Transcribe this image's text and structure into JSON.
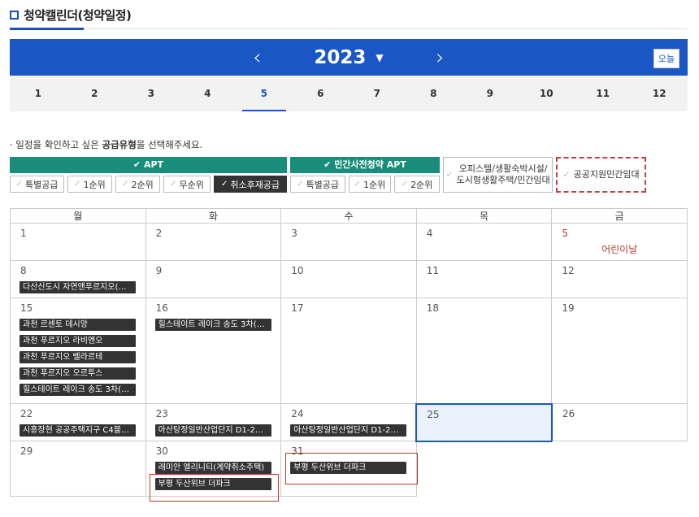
{
  "page_title": "청약캘린더(청약일정)",
  "year": "2023",
  "today_label": "오늘",
  "months": [
    "1",
    "2",
    "3",
    "4",
    "5",
    "6",
    "7",
    "8",
    "9",
    "10",
    "11",
    "12"
  ],
  "active_month": "5",
  "notice_prefix": "· 일정을 확인하고 싶은 ",
  "notice_bold": "공급유형",
  "notice_suffix": "을 선택해주세요.",
  "apt_group": {
    "label": "APT",
    "chips": [
      "특별공급",
      "1순위",
      "2순위",
      "무순위",
      "취소후재공급"
    ],
    "selected": "취소후재공급"
  },
  "pre_group": {
    "label": "민간사전청약 APT",
    "chips": [
      "특별공급",
      "1순위",
      "2순위"
    ]
  },
  "officetel": {
    "line1": "오피스텔/생활숙박시설/",
    "line2": "도시형생활주택/민간임대"
  },
  "public_rental": "공공지원민간임대",
  "weekdays": [
    "월",
    "화",
    "수",
    "목",
    "금"
  ],
  "weeks": [
    [
      {
        "day": "1",
        "events": []
      },
      {
        "day": "2",
        "events": []
      },
      {
        "day": "3",
        "events": []
      },
      {
        "day": "4",
        "events": []
      },
      {
        "day": "5",
        "holiday": "어린이날",
        "events": []
      }
    ],
    [
      {
        "day": "8",
        "events": [
          "다산신도시 자연앤푸르지오(계…"
        ]
      },
      {
        "day": "9",
        "events": []
      },
      {
        "day": "10",
        "events": []
      },
      {
        "day": "11",
        "events": []
      },
      {
        "day": "12",
        "events": []
      }
    ],
    [
      {
        "day": "15",
        "events": [
          "과천 르센토 데시앙",
          "과천 푸르지오 라비엔오",
          "과천 푸르지오 벨라르테",
          "과천 푸르지오 오르투스",
          "힐스테이트 레이크 송도 3차(계…"
        ]
      },
      {
        "day": "16",
        "events": [
          "힐스테이트 레이크 송도 3차(계…"
        ]
      },
      {
        "day": "17",
        "events": []
      },
      {
        "day": "18",
        "events": []
      },
      {
        "day": "19",
        "events": []
      }
    ],
    [
      {
        "day": "22",
        "events": [
          "시흥장현 공공주택지구 C4블록 …"
        ]
      },
      {
        "day": "23",
        "events": [
          "아산탕정일반산업단지 D1-2BL …"
        ]
      },
      {
        "day": "24",
        "events": [
          "아산탕정일반산업단지 D1-2BL…"
        ]
      },
      {
        "day": "25",
        "events": []
      },
      {
        "day": "26",
        "events": []
      }
    ],
    [
      {
        "day": "29",
        "events": []
      },
      {
        "day": "30",
        "events": [
          "래미안 엘리니티(계약취소주택)",
          "부평 두산위브 더파크"
        ]
      },
      {
        "day": "31",
        "events": [
          "부평 두산위브 더파크"
        ]
      }
    ]
  ]
}
